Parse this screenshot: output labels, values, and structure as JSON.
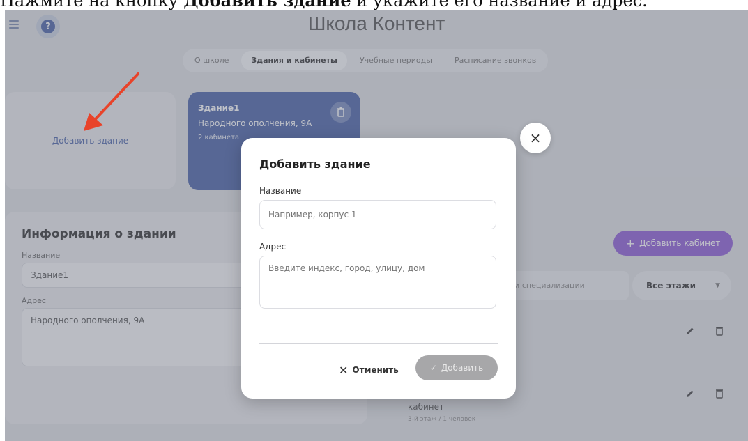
{
  "instruction": {
    "prefix": "Нажмите на кнопку ",
    "bold": "Добавить здание",
    "suffix": " и укажите его название и адрес."
  },
  "header": {
    "title": "Школа Контент",
    "menu_icon": "hamburger-icon",
    "help_icon": "question-icon"
  },
  "tabs": [
    {
      "label": "О школе",
      "active": false
    },
    {
      "label": "Здания и кабинеты",
      "active": true
    },
    {
      "label": "Учебные периоды",
      "active": false
    },
    {
      "label": "Расписание звонков",
      "active": false
    }
  ],
  "add_building": {
    "label": "Добавить здание"
  },
  "building_card": {
    "name": "Здание1",
    "address": "Народного ополчения, 9А",
    "rooms": "2 кабинета"
  },
  "info": {
    "title": "Информация о здании",
    "name_label": "Название",
    "name_value": "Здание1",
    "address_label": "Адрес",
    "address_value": "Народного ополчения, 9А"
  },
  "rooms_panel": {
    "add_room_label": "Добавить кабинет",
    "search_placeholder": "или специализации",
    "floors_label": "Все этажи",
    "room_name": "кабинет",
    "room_meta": "3-й этаж / 1 человек"
  },
  "modal": {
    "title": "Добавить здание",
    "name_label": "Название",
    "name_placeholder": "Например, корпус 1",
    "address_label": "Адрес",
    "address_placeholder": "Введите индекс, город, улицу, дом",
    "cancel_label": "Отменить",
    "submit_label": "Добавить",
    "close_icon": "close-icon"
  },
  "colors": {
    "accent_blue": "#4a63a8",
    "accent_purple": "#8e5ed6",
    "arrow_red": "#e8432a",
    "disabled_gray": "#a7a7a9"
  }
}
